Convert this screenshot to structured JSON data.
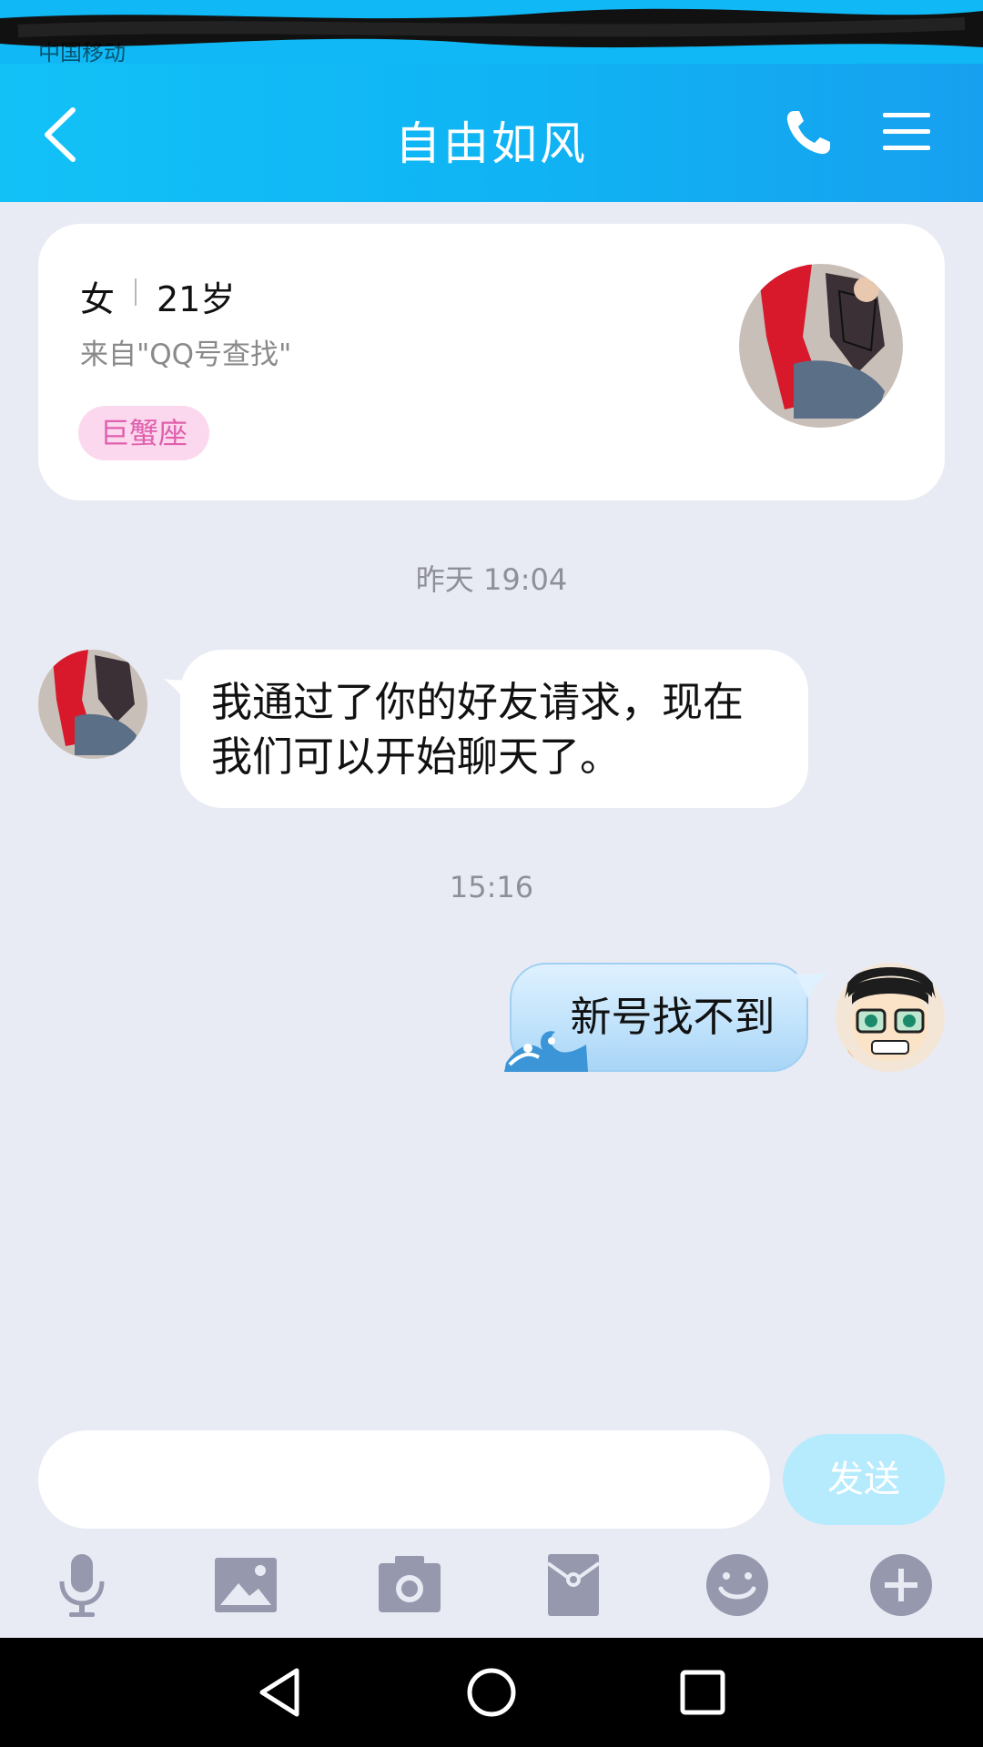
{
  "status_bar": {
    "carrier": "中国移动"
  },
  "header": {
    "title": "自由如风"
  },
  "profile_card": {
    "gender": "女",
    "age": "21岁",
    "source": "来自\"QQ号查找\"",
    "tag": "巨蟹座"
  },
  "messages": [
    {
      "type": "time",
      "text": "昨天 19:04"
    },
    {
      "type": "incoming",
      "text": "我通过了你的好友请求，现在我们可以开始聊天了。"
    },
    {
      "type": "time",
      "text": "15:16"
    },
    {
      "type": "outgoing",
      "text": "新号找不到"
    }
  ],
  "input": {
    "value": "",
    "send_label": "发送"
  },
  "toolbar": [
    "microphone-icon",
    "image-icon",
    "camera-icon",
    "red-packet-icon",
    "emoji-icon",
    "plus-icon"
  ],
  "colors": {
    "header": "#12b8f6",
    "background": "#e9ebf4",
    "tag_bg": "#fbd8ee",
    "tag_text": "#e060ad",
    "send_button": "#b5ebfc",
    "toolbar_icon": "#9698ad"
  }
}
